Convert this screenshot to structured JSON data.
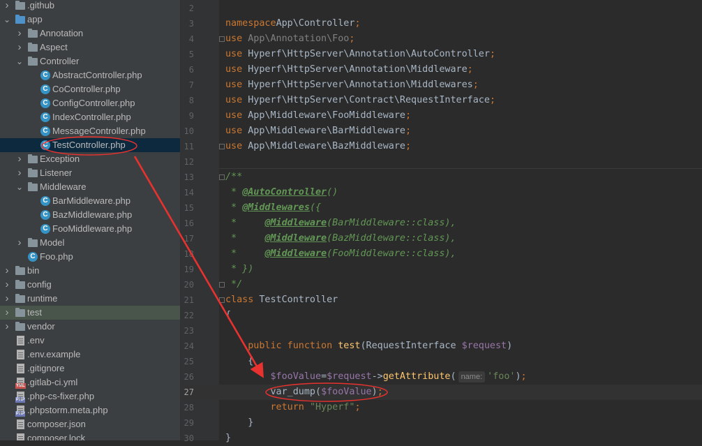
{
  "project_tree": [
    {
      "label": ".github",
      "type": "folder",
      "level": 0,
      "expanded": false
    },
    {
      "label": "app",
      "type": "folder-blue",
      "level": 0,
      "expanded": true
    },
    {
      "label": "Annotation",
      "type": "folder",
      "level": 1,
      "expanded": false
    },
    {
      "label": "Aspect",
      "type": "folder",
      "level": 1,
      "expanded": false
    },
    {
      "label": "Controller",
      "type": "folder",
      "level": 1,
      "expanded": true
    },
    {
      "label": "AbstractController.php",
      "type": "class-file",
      "level": 2
    },
    {
      "label": "CoController.php",
      "type": "class-file",
      "level": 2
    },
    {
      "label": "ConfigController.php",
      "type": "class-file",
      "level": 2
    },
    {
      "label": "IndexController.php",
      "type": "class-file",
      "level": 2
    },
    {
      "label": "MessageController.php",
      "type": "class-file",
      "level": 2
    },
    {
      "label": "TestController.php",
      "type": "class-file",
      "level": 2,
      "selected": true
    },
    {
      "label": "Exception",
      "type": "folder",
      "level": 1,
      "expanded": false
    },
    {
      "label": "Listener",
      "type": "folder",
      "level": 1,
      "expanded": false
    },
    {
      "label": "Middleware",
      "type": "folder",
      "level": 1,
      "expanded": true
    },
    {
      "label": "BarMiddleware.php",
      "type": "class-file",
      "level": 2
    },
    {
      "label": "BazMiddleware.php",
      "type": "class-file",
      "level": 2
    },
    {
      "label": "FooMiddleware.php",
      "type": "class-file",
      "level": 2
    },
    {
      "label": "Model",
      "type": "folder",
      "level": 1,
      "expanded": false
    },
    {
      "label": "Foo.php",
      "type": "class-file",
      "level": 1
    },
    {
      "label": "bin",
      "type": "folder",
      "level": 0,
      "expanded": false
    },
    {
      "label": "config",
      "type": "folder",
      "level": 0,
      "expanded": false
    },
    {
      "label": "runtime",
      "type": "folder",
      "level": 0,
      "expanded": false
    },
    {
      "label": "test",
      "type": "folder",
      "level": 0,
      "expanded": false,
      "highlight": true
    },
    {
      "label": "vendor",
      "type": "folder",
      "level": 0,
      "expanded": false
    },
    {
      "label": ".env",
      "type": "text-file",
      "level": 0
    },
    {
      "label": ".env.example",
      "type": "text-file",
      "level": 0
    },
    {
      "label": ".gitignore",
      "type": "text-file",
      "level": 0
    },
    {
      "label": ".gitlab-ci.yml",
      "type": "yml-file",
      "level": 0
    },
    {
      "label": ".php-cs-fixer.php",
      "type": "php-file",
      "level": 0
    },
    {
      "label": ".phpstorm.meta.php",
      "type": "php-file",
      "level": 0
    },
    {
      "label": "composer.json",
      "type": "text-file",
      "level": 0
    },
    {
      "label": "composer.lock",
      "type": "text-file",
      "level": 0
    }
  ],
  "editor": {
    "current_line": "27",
    "lines": [
      {
        "n": "2",
        "tokens": []
      },
      {
        "n": "3",
        "tokens": [
          [
            "kw",
            "namespace"
          ],
          [
            "",
            "App\\Controller"
          ],
          [
            "kw",
            ";"
          ]
        ]
      },
      {
        "n": "4",
        "tokens": [
          [
            "kw",
            "use "
          ],
          [
            "dim",
            "App\\Annotation\\Foo"
          ],
          [
            "kw",
            ";"
          ]
        ]
      },
      {
        "n": "5",
        "tokens": [
          [
            "kw",
            "use "
          ],
          [
            "",
            "Hyperf\\HttpServer\\Annotation\\AutoController"
          ],
          [
            "kw",
            ";"
          ]
        ]
      },
      {
        "n": "6",
        "tokens": [
          [
            "kw",
            "use "
          ],
          [
            "",
            "Hyperf\\HttpServer\\Annotation\\Middleware"
          ],
          [
            "kw",
            ";"
          ]
        ]
      },
      {
        "n": "7",
        "tokens": [
          [
            "kw",
            "use "
          ],
          [
            "",
            "Hyperf\\HttpServer\\Annotation\\Middlewares"
          ],
          [
            "kw",
            ";"
          ]
        ]
      },
      {
        "n": "8",
        "tokens": [
          [
            "kw",
            "use "
          ],
          [
            "",
            "Hyperf\\HttpServer\\Contract\\RequestInterface"
          ],
          [
            "kw",
            ";"
          ]
        ]
      },
      {
        "n": "9",
        "tokens": [
          [
            "kw",
            "use "
          ],
          [
            "",
            "App\\Middleware\\FooMiddleware"
          ],
          [
            "kw",
            ";"
          ]
        ]
      },
      {
        "n": "10",
        "tokens": [
          [
            "kw",
            "use "
          ],
          [
            "",
            "App\\Middleware\\BarMiddleware"
          ],
          [
            "kw",
            ";"
          ]
        ]
      },
      {
        "n": "11",
        "tokens": [
          [
            "kw",
            "use "
          ],
          [
            "",
            "App\\Middleware\\BazMiddleware"
          ],
          [
            "kw",
            ";"
          ]
        ]
      },
      {
        "n": "12",
        "tokens": []
      },
      {
        "n": "13",
        "tokens": [
          [
            "cm",
            "/**"
          ]
        ]
      },
      {
        "n": "14",
        "tokens": [
          [
            "cm",
            " * "
          ],
          [
            "tag",
            "@AutoController"
          ],
          [
            "cm",
            "()"
          ]
        ]
      },
      {
        "n": "15",
        "tokens": [
          [
            "cm",
            " * "
          ],
          [
            "tag",
            "@Middlewares"
          ],
          [
            "cm",
            "({"
          ]
        ]
      },
      {
        "n": "16",
        "tokens": [
          [
            "cm",
            " *     "
          ],
          [
            "tag",
            "@Middleware"
          ],
          [
            "cm",
            "(BarMiddleware::class),"
          ]
        ]
      },
      {
        "n": "17",
        "tokens": [
          [
            "cm",
            " *     "
          ],
          [
            "tag",
            "@Middleware"
          ],
          [
            "cm",
            "(BazMiddleware::class),"
          ]
        ]
      },
      {
        "n": "18",
        "tokens": [
          [
            "cm",
            " *     "
          ],
          [
            "tag",
            "@Middleware"
          ],
          [
            "cm",
            "(FooMiddleware::class),"
          ]
        ]
      },
      {
        "n": "19",
        "tokens": [
          [
            "cm",
            " * })"
          ]
        ]
      },
      {
        "n": "20",
        "tokens": [
          [
            "cm",
            " */"
          ]
        ]
      },
      {
        "n": "21",
        "tokens": [
          [
            "kw",
            "class "
          ],
          [
            "",
            "TestController"
          ]
        ]
      },
      {
        "n": "22",
        "tokens": [
          [
            "",
            "{"
          ]
        ]
      },
      {
        "n": "23",
        "tokens": []
      },
      {
        "n": "24",
        "tokens": [
          [
            "kw",
            "    public function "
          ],
          [
            "fn",
            "test"
          ],
          [
            "",
            "(RequestInterface "
          ],
          [
            "var",
            "$request"
          ],
          [
            "",
            ")"
          ]
        ]
      },
      {
        "n": "25",
        "tokens": [
          [
            "",
            "    {"
          ]
        ]
      },
      {
        "n": "26",
        "tokens": [
          [
            "var",
            "        $fooValue"
          ],
          [
            "",
            "="
          ],
          [
            "var",
            "$request"
          ],
          [
            "",
            "->"
          ],
          [
            "fn",
            "getAttribute"
          ],
          [
            "",
            "("
          ],
          [
            "hint",
            "name:"
          ],
          [
            "str",
            "'foo'"
          ],
          [
            "",
            ")"
          ],
          [
            "kw",
            ";"
          ]
        ]
      },
      {
        "n": "27",
        "tokens": [
          [
            "",
            "        var_dump("
          ],
          [
            "var",
            "$fooValue"
          ],
          [
            "",
            ")"
          ],
          [
            "kw",
            ";"
          ]
        ]
      },
      {
        "n": "28",
        "tokens": [
          [
            "kw",
            "        return "
          ],
          [
            "str",
            "\"Hyperf\""
          ],
          [
            "kw",
            ";"
          ]
        ]
      },
      {
        "n": "29",
        "tokens": [
          [
            "",
            "    }"
          ]
        ]
      },
      {
        "n": "30",
        "tokens": [
          [
            "",
            "}"
          ]
        ]
      }
    ]
  },
  "colors": {
    "sidebar_bg": "#3c3f41",
    "editor_bg": "#2b2b2b",
    "keyword": "#cc7832",
    "comment": "#629755",
    "annotation_arrow": "#e8322f"
  }
}
